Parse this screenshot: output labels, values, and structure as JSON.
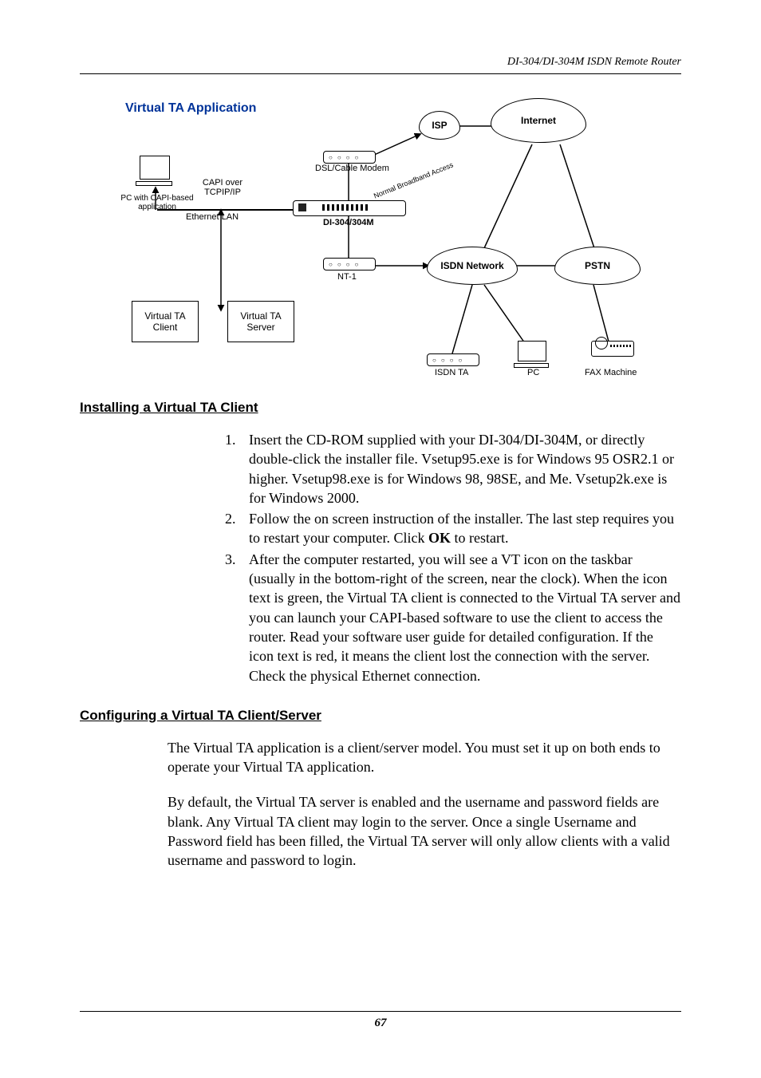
{
  "header": {
    "running_title": "DI-304/DI-304M ISDN Remote Router"
  },
  "diagram": {
    "title": "Virtual TA Application",
    "pc_label_line1": "PC with CAPI-based",
    "pc_label_line2": "application",
    "capi_line1": "CAPI over",
    "capi_line2": "TCPIP/IP",
    "ethernet_label": "Ethernet LAN",
    "vta_client_box": "Virtual TA Client",
    "vta_server_box": "Virtual TA Server",
    "dsl_label": "DSL/Cable Modem",
    "router_label": "DI-304/304M",
    "nt1_label": "NT-1",
    "isp_label": "ISP",
    "internet_label": "Internet",
    "broadband_label": "Normal Broadband Access",
    "isdn_net_label": "ISDN Network",
    "pstn_label": "PSTN",
    "isdn_ta_label": "ISDN TA",
    "pc2_label": "PC",
    "fax_label": "FAX Machine"
  },
  "sections": {
    "install_heading": "Installing a Virtual TA Client",
    "install_items": [
      "Insert the CD-ROM supplied with your DI-304/DI-304M, or directly double-click the installer file. Vsetup95.exe is for Windows 95 OSR2.1 or higher. Vsetup98.exe is for Windows 98, 98SE, and Me. Vsetup2k.exe is for Windows 2000.",
      "Follow the on screen instruction of the installer. The last step requires you to restart your computer. Click OK to restart.",
      "After the computer restarted, you will see a VT icon on the taskbar (usually in the bottom-right of the screen, near the clock). When the icon text is green, the Virtual TA client is connected to the Virtual TA server and you can launch your CAPI-based software to use the client to access the router. Read your software user guide for detailed configuration. If the icon text is red, it means the client lost the connection with the server. Check the physical Ethernet connection."
    ],
    "config_heading": "Configuring a Virtual TA Client/Server",
    "config_para1": "The Virtual TA application is a client/server model. You must set it up on both ends to operate your Virtual TA application.",
    "config_para2": "By default, the Virtual TA server is enabled and the username and password fields are blank. Any Virtual TA client may login to the server. Once a single Username and Password field has been filled, the Virtual TA server will only allow clients with a valid username and password to login."
  },
  "footer": {
    "page_number": "67"
  }
}
